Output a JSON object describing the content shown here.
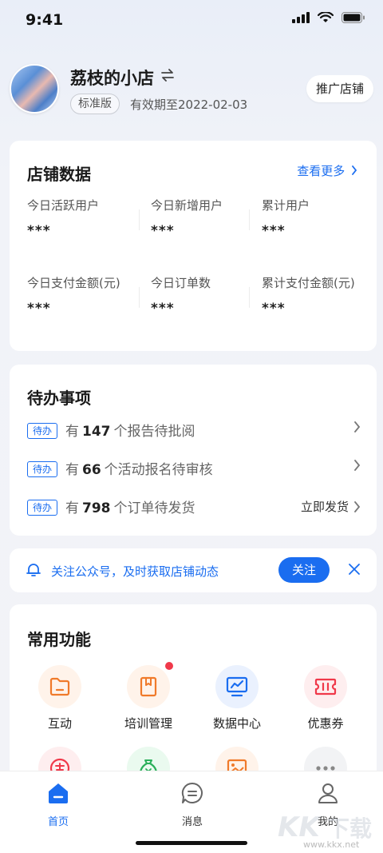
{
  "status_bar": {
    "time": "9:41"
  },
  "header": {
    "shop_name": "荔枝的小店",
    "edition": "标准版",
    "validity": "有效期至2022-02-03",
    "promote_label": "推广店铺"
  },
  "stats": {
    "title": "店铺数据",
    "more_label": "查看更多",
    "items": [
      {
        "label": "今日活跃用户",
        "value": "***"
      },
      {
        "label": "今日新增用户",
        "value": "***"
      },
      {
        "label": "累计用户",
        "value": "***"
      },
      {
        "label": "今日支付金额(元)",
        "value": "***"
      },
      {
        "label": "今日订单数",
        "value": "***"
      },
      {
        "label": "累计支付金额(元)",
        "value": "***"
      }
    ]
  },
  "todo": {
    "title": "待办事项",
    "tag": "待办",
    "rows": [
      {
        "prefix": "有",
        "count": "147",
        "suffix": "个报告待批阅",
        "action": ""
      },
      {
        "prefix": "有",
        "count": "66",
        "suffix": "个活动报名待审核",
        "action": ""
      },
      {
        "prefix": "有",
        "count": "798",
        "suffix": "个订单待发货",
        "action": "立即发货"
      }
    ]
  },
  "notice": {
    "text": "关注公众号，及时获取店铺动态",
    "follow_label": "关注"
  },
  "functions": {
    "title": "常用功能",
    "items": [
      {
        "label": "互动",
        "icon": "folder-icon",
        "color": "#f07a2a",
        "bg": "#fff3ea"
      },
      {
        "label": "培训管理",
        "icon": "book-icon",
        "color": "#f07a2a",
        "bg": "#fff3ea",
        "badge": true
      },
      {
        "label": "数据中心",
        "icon": "chart-icon",
        "color": "#1a6df0",
        "bg": "#eaf1fe"
      },
      {
        "label": "优惠券",
        "icon": "coupon-icon",
        "color": "#f0394a",
        "bg": "#feeeef"
      }
    ],
    "row2_icons": [
      {
        "icon": "invite-icon",
        "color": "#f0394a",
        "bg": "#feeeef"
      },
      {
        "icon": "money-bag-icon",
        "color": "#2ab05a",
        "bg": "#eafaef"
      },
      {
        "icon": "image-icon",
        "color": "#f07a2a",
        "bg": "#fff3ea"
      },
      {
        "icon": "more-icon",
        "color": "#888888",
        "bg": "#f2f3f5"
      }
    ]
  },
  "tabbar": {
    "items": [
      {
        "label": "首页",
        "active": true
      },
      {
        "label": "消息",
        "active": false
      },
      {
        "label": "我的",
        "active": false
      }
    ]
  },
  "watermark": {
    "text": "www.kkx.net"
  },
  "colors": {
    "accent": "#1a6df0",
    "badge_red": "#f0394a"
  }
}
